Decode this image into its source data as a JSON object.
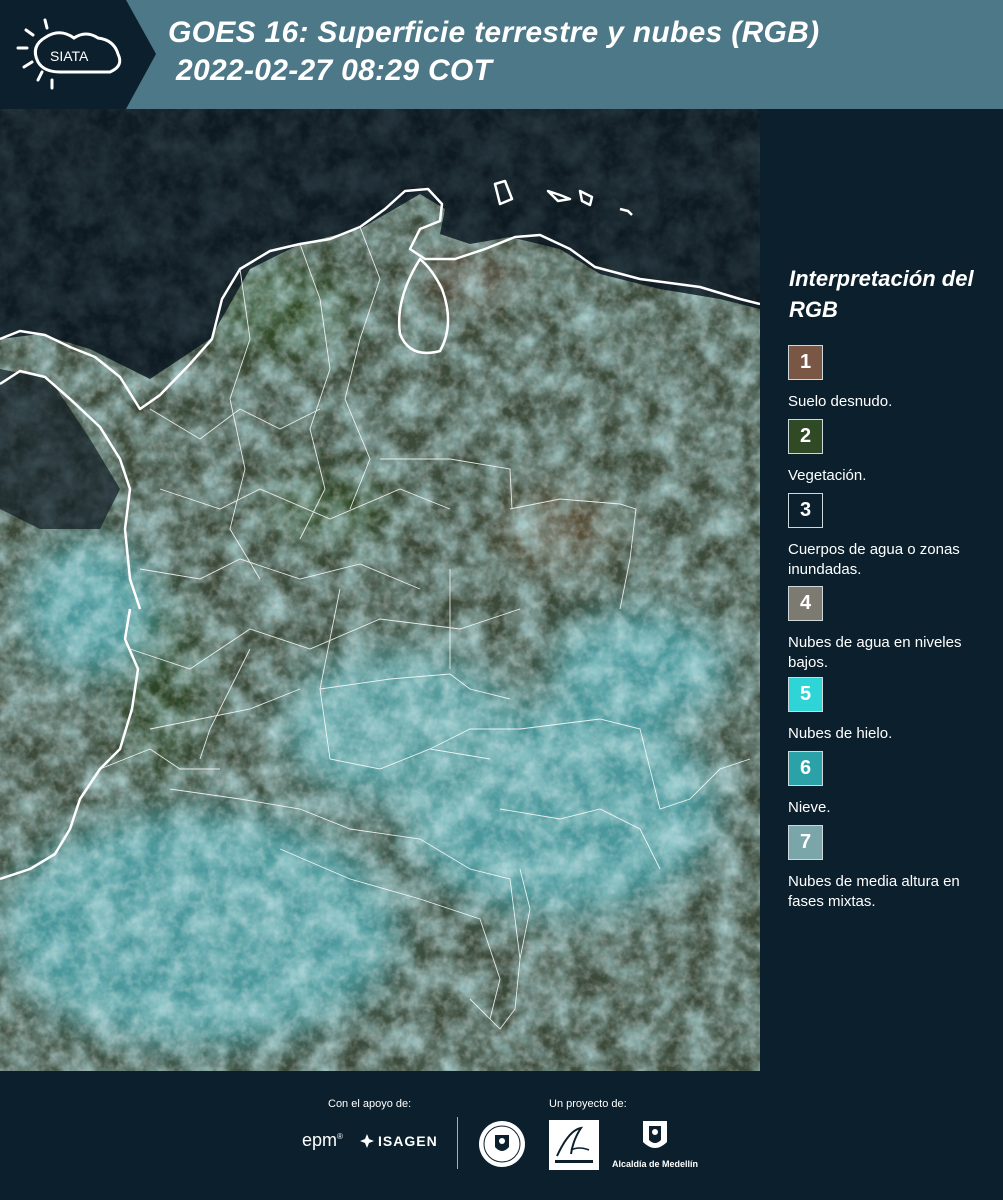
{
  "header": {
    "logo_text": "SIATA",
    "title_line1": "GOES 16: Superficie terrestre y nubes (RGB)",
    "title_line2": "2022-02-27 08:29 COT"
  },
  "legend": {
    "title": "Interpretación del RGB",
    "items": [
      {
        "number": "1",
        "label": "Suelo desnudo.",
        "color": "#7a5645"
      },
      {
        "number": "2",
        "label": "Vegetación.",
        "color": "#2f4a24"
      },
      {
        "number": "3",
        "label": "Cuerpos de agua o zonas inundadas.",
        "color": "#0b1f2c"
      },
      {
        "number": "4",
        "label": "Nubes de agua en niveles bajos.",
        "color": "#7d7a72"
      },
      {
        "number": "5",
        "label": "Nubes de hielo.",
        "color": "#2ed4d6"
      },
      {
        "number": "6",
        "label": "Nieve.",
        "color": "#2aa2a8"
      },
      {
        "number": "7",
        "label": "Nubes de media altura en fases mixtas.",
        "color": "#7aa6aa"
      }
    ]
  },
  "footer": {
    "support_label": "Con el apoyo de:",
    "project_label": "Un proyecto de:",
    "epm": "epm",
    "isagen": "ISAGEN",
    "alcaldia": "Alcaldía de Medellín"
  },
  "colors": {
    "header_bg": "#4d7888",
    "logo_bg": "#0b1f2c",
    "panel_bg": "#0b1f2c",
    "ocean": "#0e1a22",
    "cloud_cyan": "#4fb3bd",
    "land": "#3e4a36"
  }
}
